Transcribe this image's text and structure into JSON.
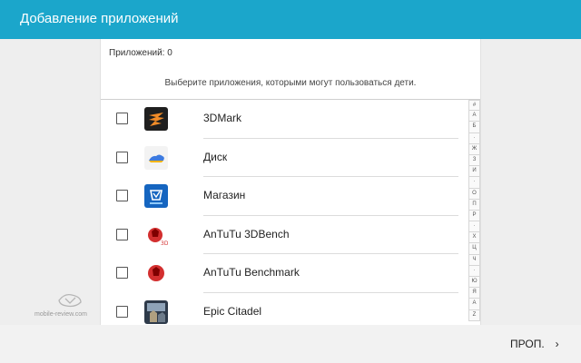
{
  "header": {
    "title": "Добавление приложений"
  },
  "panel": {
    "count_label": "Приложений: 0",
    "hint": "Выберите приложения, которыми могут пользоваться дети."
  },
  "apps": [
    {
      "name": "3DMark",
      "icon": "3dmark-icon",
      "checked": false
    },
    {
      "name": "Диск",
      "icon": "drive-icon",
      "checked": false
    },
    {
      "name": "Магазин",
      "icon": "galaxy-store-icon",
      "checked": false
    },
    {
      "name": "AnTuTu 3DBench",
      "icon": "antutu-3dbench-icon",
      "checked": false
    },
    {
      "name": "AnTuTu Benchmark",
      "icon": "antutu-benchmark-icon",
      "checked": false
    },
    {
      "name": "Epic Citadel",
      "icon": "epic-citadel-icon",
      "checked": false
    }
  ],
  "alphabet_index": [
    "#",
    "А",
    "Б",
    "·",
    "Ж",
    "З",
    "И",
    "·",
    "О",
    "П",
    "Р",
    "·",
    "Х",
    "Ц",
    "Ч",
    "·",
    "Ю",
    "Я",
    "A",
    "Z"
  ],
  "watermark": {
    "text": "mobile-review.com"
  },
  "footer": {
    "skip_label": "ПРОП.",
    "chevron": "›"
  },
  "colors": {
    "accent": "#1ba6cb",
    "antutu_red": "#d32f2f",
    "store_blue": "#1565c0"
  }
}
